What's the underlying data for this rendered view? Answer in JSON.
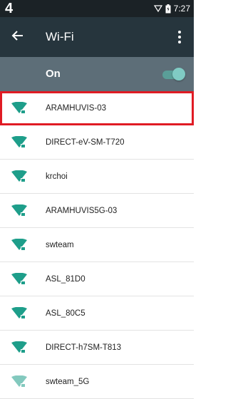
{
  "status_bar": {
    "left_number": "4",
    "time": "7:27",
    "icons": [
      "signal-icon",
      "battery-icon"
    ]
  },
  "app_bar": {
    "title": "Wi-Fi",
    "back_icon": "arrow-back-icon",
    "menu_icon": "more-vert-icon"
  },
  "switch_bar": {
    "label": "On",
    "state": true
  },
  "networks": [
    {
      "ssid": "ARAMHUVIS-03",
      "selected": true
    },
    {
      "ssid": "DIRECT-eV-SM-T720"
    },
    {
      "ssid": "krchoi"
    },
    {
      "ssid": "ARAMHUVIS5G-03"
    },
    {
      "ssid": "swteam"
    },
    {
      "ssid": "ASL_81D0"
    },
    {
      "ssid": "ASL_80C5"
    },
    {
      "ssid": "DIRECT-h7SM-T813"
    },
    {
      "ssid": "swteam_5G"
    }
  ],
  "colors": {
    "status_bar": "#1b2226",
    "app_bar": "#26353d",
    "switch_bar": "#5d6e78",
    "wifi_icon": "#1e9e8a",
    "toggle_on": "#80cbc4",
    "selection_outline": "#e01b24"
  }
}
